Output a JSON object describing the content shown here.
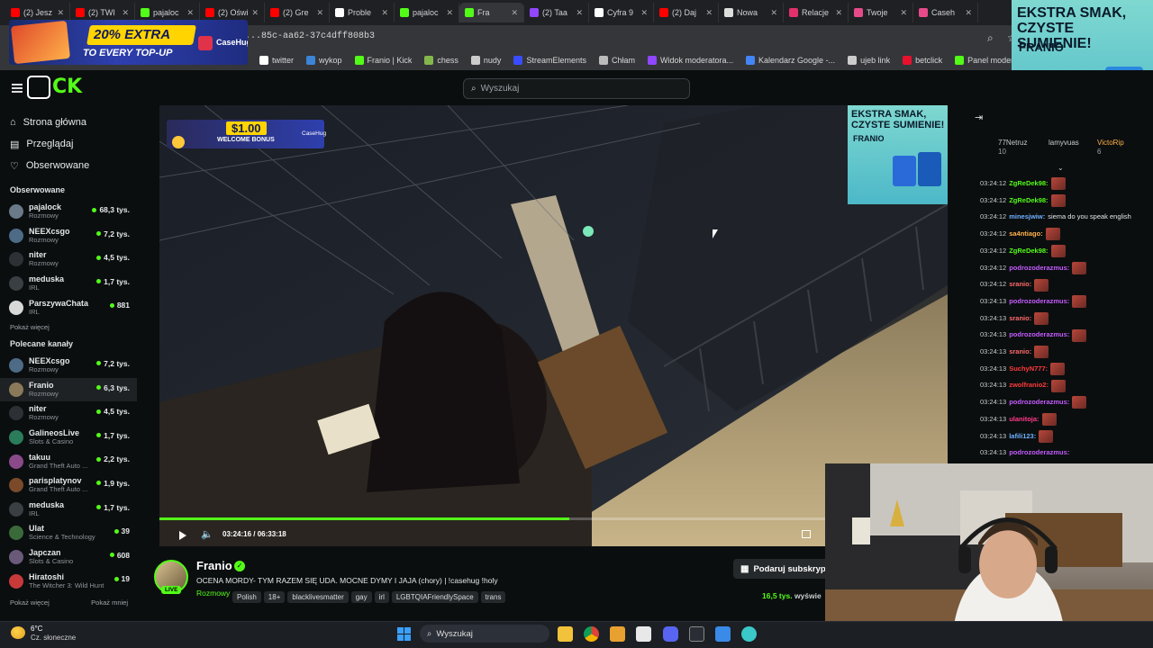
{
  "browser": {
    "tabs": [
      {
        "label": "(2) Jesz",
        "color": "#ff0000"
      },
      {
        "label": "(2) TWI",
        "color": "#ff0000"
      },
      {
        "label": "pajaloc",
        "color": "#53fc18"
      },
      {
        "label": "(2) Oświ",
        "color": "#ff0000"
      },
      {
        "label": "(2) Gre",
        "color": "#ff0000"
      },
      {
        "label": "Proble",
        "color": "#ffffff"
      },
      {
        "label": "pajaloc",
        "color": "#53fc18"
      },
      {
        "label": "Fra",
        "color": "#53fc18",
        "active": true
      },
      {
        "label": "(2) Taa",
        "color": "#9146ff"
      },
      {
        "label": "Cyfra 9",
        "color": "#ffffff"
      },
      {
        "label": "(2) Daj",
        "color": "#ff0000"
      },
      {
        "label": "Nowa",
        "color": "#dddddd"
      },
      {
        "label": "Relacje",
        "color": "#e1306c"
      },
      {
        "label": "Twoje",
        "color": "#e64a8a"
      },
      {
        "label": "Caseh",
        "color": "#e64a8a"
      }
    ],
    "url": "...85c-aa62-37c4dff808b3",
    "bookmarks": [
      {
        "label": "twitter",
        "color": "#ffffff"
      },
      {
        "label": "wykop",
        "color": "#3c85d6"
      },
      {
        "label": "Franio | Kick",
        "color": "#53fc18"
      },
      {
        "label": "chess",
        "color": "#84b74b"
      },
      {
        "label": "nudy",
        "color": "#cccccc"
      },
      {
        "label": "StreamElements",
        "color": "#3a4cff"
      },
      {
        "label": "Chłam",
        "color": "#bbbbbb"
      },
      {
        "label": "Widok moderatora...",
        "color": "#9146ff"
      },
      {
        "label": "Kalendarz Google -...",
        "color": "#4285f4"
      },
      {
        "label": "ujeb link",
        "color": "#cccccc"
      },
      {
        "label": "betclick",
        "color": "#e8112d"
      },
      {
        "label": "Panel moderatora |...",
        "color": "#53fc18"
      }
    ]
  },
  "ads": {
    "top_left_text": "20% EXTRA",
    "top_left_sub": "TO EVERY TOP-UP",
    "top_left_brand": "CaseHug",
    "top_right_title": "EKSTRA SMAK, CZYSTE SUMIENIE!",
    "top_right_brand": "FRANIO",
    "overlay_bonus": "$1.00",
    "overlay_bonus_sub": "WELCOME BONUS",
    "overlay_bonus_brand": "CaseHug",
    "overlay_right_title": "EKSTRA SMAK, CZYSTE SUMIENIE!",
    "overlay_right_brand": "FRANIO"
  },
  "header": {
    "search_placeholder": "Wyszukaj"
  },
  "sidebar": {
    "nav": [
      {
        "label": "Strona główna",
        "icon": "home-icon"
      },
      {
        "label": "Przeglądaj",
        "icon": "browse-icon"
      },
      {
        "label": "Obserwowane",
        "icon": "heart-icon"
      }
    ],
    "followed_title": "Obserwowane",
    "followed": [
      {
        "name": "pajalock",
        "category": "Rozmowy",
        "viewers": "68,3 tys.",
        "color": "#6a7a88"
      },
      {
        "name": "NEEXcsgo",
        "category": "Rozmowy",
        "viewers": "7,2 tys.",
        "color": "#4d6a86"
      },
      {
        "name": "niter",
        "category": "Rozmowy",
        "viewers": "4,5 tys.",
        "color": "#2d3136"
      },
      {
        "name": "meduska",
        "category": "IRL",
        "viewers": "1,7 tys.",
        "color": "#3a3f44"
      },
      {
        "name": "ParszywaChata",
        "category": "IRL",
        "viewers": "881",
        "color": "#d8d8d8"
      }
    ],
    "show_more": "Pokaż więcej",
    "recommended_title": "Polecane kanały",
    "recommended": [
      {
        "name": "NEEXcsgo",
        "category": "Rozmowy",
        "viewers": "7,2 tys.",
        "color": "#4d6a86"
      },
      {
        "name": "Franio",
        "category": "Rozmowy",
        "viewers": "6,3 tys.",
        "color": "#8a7a5a",
        "selected": true
      },
      {
        "name": "niter",
        "category": "Rozmowy",
        "viewers": "4,5 tys.",
        "color": "#2d3136"
      },
      {
        "name": "GalineosLive",
        "category": "Slots & Casino",
        "viewers": "1,7 tys.",
        "color": "#2a7c5a"
      },
      {
        "name": "takuu",
        "category": "Grand Theft Auto ...",
        "viewers": "2,2 tys.",
        "color": "#8a4a8a"
      },
      {
        "name": "parisplatynov",
        "category": "Grand Theft Auto ...",
        "viewers": "1,9 tys.",
        "color": "#7a4a2a"
      },
      {
        "name": "meduska",
        "category": "IRL",
        "viewers": "1,7 tys.",
        "color": "#3a3f44"
      },
      {
        "name": "Ulat",
        "category": "Science & Technology",
        "viewers": "39",
        "color": "#3a6a3a"
      },
      {
        "name": "Japczan",
        "category": "Slots & Casino",
        "viewers": "608",
        "color": "#6a5a7a"
      },
      {
        "name": "Hiratoshi",
        "category": "The Witcher 3: Wild Hunt",
        "viewers": "19",
        "color": "#c83a3a"
      }
    ],
    "show_more_2": "Pokaż więcej",
    "show_less": "Pokaż mniej"
  },
  "player": {
    "time": "03:24:16 / 06:33:18",
    "progress": 0.52
  },
  "stream": {
    "streamer": "Franio",
    "live_badge": "LIVE",
    "title": "OCENA MORDY- TYM RAZEM SIĘ UDA. MOCNE DYMY I JAJA (chory) | !casehug !holy",
    "category": "Rozmowy",
    "tags": [
      "Polish",
      "18+",
      "blacklivesmatter",
      "gay",
      "irl",
      "LGBTQIAFriendlySpace",
      "trans"
    ],
    "subscribe": "Podaruj subskryp",
    "viewers": "16,5 tys.",
    "viewers_label": "wyświe"
  },
  "chat": {
    "leaderboard": [
      {
        "name": "77Netruz",
        "score": "10"
      },
      {
        "name": "lamyvuas",
        "score": ""
      },
      {
        "name": "VictoRip",
        "score": "6"
      }
    ],
    "messages": [
      {
        "time": "03:24:12",
        "user": "ZgReDek98:",
        "color": "#53fc18",
        "text": "",
        "emote": true
      },
      {
        "time": "03:24:12",
        "user": "ZgReDek98:",
        "color": "#53fc18",
        "text": "",
        "emote": true
      },
      {
        "time": "03:24:12",
        "user": "minesjwiw:",
        "color": "#6fb0ff",
        "text": "siema do you speak english",
        "emote": false
      },
      {
        "time": "03:24:12",
        "user": "sa4ntiago:",
        "color": "#ffb14a",
        "text": "",
        "emote": true
      },
      {
        "time": "03:24:12",
        "user": "ZgReDek98:",
        "color": "#53fc18",
        "text": "",
        "emote": true
      },
      {
        "time": "03:24:12",
        "user": "podrozoderazmus:",
        "color": "#c45cff",
        "text": "",
        "emote": true
      },
      {
        "time": "03:24:12",
        "user": "sranio:",
        "color": "#ff6a6a",
        "text": "",
        "emote": true
      },
      {
        "time": "03:24:13",
        "user": "podrozoderazmus:",
        "color": "#c45cff",
        "text": "",
        "emote": true
      },
      {
        "time": "03:24:13",
        "user": "sranio:",
        "color": "#ff6a6a",
        "text": "",
        "emote": true
      },
      {
        "time": "03:24:13",
        "user": "podrozoderazmus:",
        "color": "#c45cff",
        "text": "",
        "emote": true
      },
      {
        "time": "03:24:13",
        "user": "sranio:",
        "color": "#ff6a6a",
        "text": "",
        "emote": true
      },
      {
        "time": "03:24:13",
        "user": "SuchyN777:",
        "color": "#ff3a3a",
        "text": "",
        "emote": true
      },
      {
        "time": "03:24:13",
        "user": "zwolfranio2:",
        "color": "#ff3a3a",
        "text": "",
        "emote": true
      },
      {
        "time": "03:24:13",
        "user": "podrozoderazmus:",
        "color": "#c45cff",
        "text": "",
        "emote": true
      },
      {
        "time": "03:24:13",
        "user": "ulanitoja:",
        "color": "#ff3a8a",
        "text": "",
        "emote": true
      },
      {
        "time": "03:24:13",
        "user": "lafili123:",
        "color": "#6fb0ff",
        "text": "",
        "emote": true
      },
      {
        "time": "03:24:13",
        "user": "podrozoderazmus:",
        "color": "#c45cff",
        "text": "",
        "emote": false
      }
    ]
  },
  "taskbar": {
    "weather_temp": "6°C",
    "weather_desc": "Cz. słoneczne",
    "search_label": "Wyszukaj"
  }
}
